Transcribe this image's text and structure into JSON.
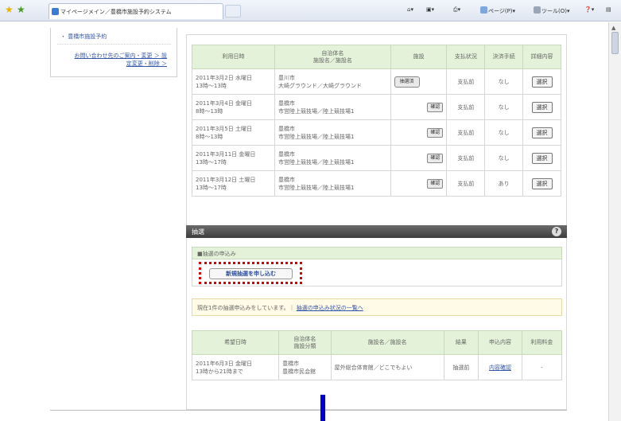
{
  "browser": {
    "tab_title": "マイページメイン／豊橋市施設予約システム",
    "commands": [
      "ページ(P)",
      "ツール(O)"
    ]
  },
  "sidebar": {
    "link1": "・ 豊橋市施設予約",
    "link2": "お問い合わせ先のご案内・変更 ＞ 設定変更・削除 ＞"
  },
  "reservations": {
    "headers": [
      "利用日時",
      "自治体名\n施設名／施設名",
      "施設",
      "支払状況",
      "決済手続",
      "詳細内容"
    ],
    "rows": [
      {
        "date": "2011年3月2日 水曜日",
        "time": "13時～13時",
        "city": "豊川市",
        "facility": "大崎グラウンド／大崎グラウンド",
        "badge": "抽選済",
        "badge_type": "wide",
        "pay": "支払前",
        "proc": "なし",
        "action": "選択"
      },
      {
        "date": "2011年3月4日 金曜日",
        "time": "8時～13時",
        "city": "豊橋市",
        "facility": "市営陸上競技場／陸上競技場1",
        "badge": "確認",
        "badge_type": "small",
        "pay": "支払前",
        "proc": "なし",
        "action": "選択"
      },
      {
        "date": "2011年3月5日 土曜日",
        "time": "8時～13時",
        "city": "豊橋市",
        "facility": "市営陸上競技場／陸上競技場1",
        "badge": "確認",
        "badge_type": "small",
        "pay": "支払前",
        "proc": "なし",
        "action": "選択"
      },
      {
        "date": "2011年3月11日 金曜日",
        "time": "13時～17時",
        "city": "豊橋市",
        "facility": "市営陸上競技場／陸上競技場1",
        "badge": "確認",
        "badge_type": "small",
        "pay": "支払前",
        "proc": "なし",
        "action": "選択"
      },
      {
        "date": "2011年3月12日 土曜日",
        "time": "13時～17時",
        "city": "豊橋市",
        "facility": "市営陸上競技場／陸上競技場1",
        "badge": "確認",
        "badge_type": "small",
        "pay": "支払前",
        "proc": "あり",
        "action": "選択"
      }
    ]
  },
  "lottery": {
    "title": "抽選",
    "help": "?",
    "section_title": "■抽選の申込み",
    "apply_button": "新規抽選を申し込む",
    "notice_text": "現在1件の抽選申込みをしています。｜",
    "notice_link": "抽選の申込み状況の一覧へ",
    "table": {
      "headers": [
        "希望日時",
        "自治体名\n施設分類",
        "施設名／施設名",
        "結果",
        "申込内容",
        "利用料金"
      ],
      "rows": [
        {
          "date": "2011年6月3日 金曜日",
          "time": "13時から21時まで",
          "city": "豊橋市",
          "category": "豊橋市民会館",
          "facility": "屋外総合体育館／どこでもよい",
          "result": "抽選前",
          "detail": "内容確認",
          "fee": "-"
        }
      ]
    }
  }
}
